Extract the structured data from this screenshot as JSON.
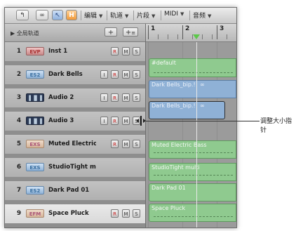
{
  "toolbar": {
    "menus": [
      {
        "label": "编辑"
      },
      {
        "label": "轨道"
      },
      {
        "label": "片段"
      },
      {
        "label": "MIDI"
      },
      {
        "label": "音频"
      }
    ]
  },
  "header": {
    "label": "全局轨道",
    "add_label": "+",
    "addlist_label": "+"
  },
  "ruler": {
    "bars": [
      "1",
      "2",
      "3"
    ]
  },
  "tracks": [
    {
      "num": "1",
      "icon": "EVP",
      "name": "Inst 1"
    },
    {
      "num": "2",
      "icon": "ES2",
      "name": "Dark Bells"
    },
    {
      "num": "3",
      "icon": "wave",
      "name": "Audio 2"
    },
    {
      "num": "4",
      "icon": "wave",
      "name": "Audio 3"
    },
    {
      "num": "5",
      "icon": "EXS",
      "name": "Muted Electric ..."
    },
    {
      "num": "6",
      "icon": "EXS",
      "name": "StudioTight multi"
    },
    {
      "num": "7",
      "icon": "ES2",
      "name": "Dark Pad 01"
    },
    {
      "num": "9",
      "icon": "EFM",
      "name": "Space Pluck"
    }
  ],
  "track_buttons": {
    "i": "I",
    "r": "R",
    "m": "M",
    "s": "S"
  },
  "regions": [
    {
      "label": "#default"
    },
    {
      "label": "Dark Bells_bip.!"
    },
    {
      "label": "Dark Bells_bip.!"
    },
    {
      "label": "Muted Electric Bass"
    },
    {
      "label": "StudioTight multi"
    },
    {
      "label": "Dark Pad 01"
    },
    {
      "label": "Space Pluck"
    }
  ],
  "callout": {
    "text": "调整大小指针"
  }
}
